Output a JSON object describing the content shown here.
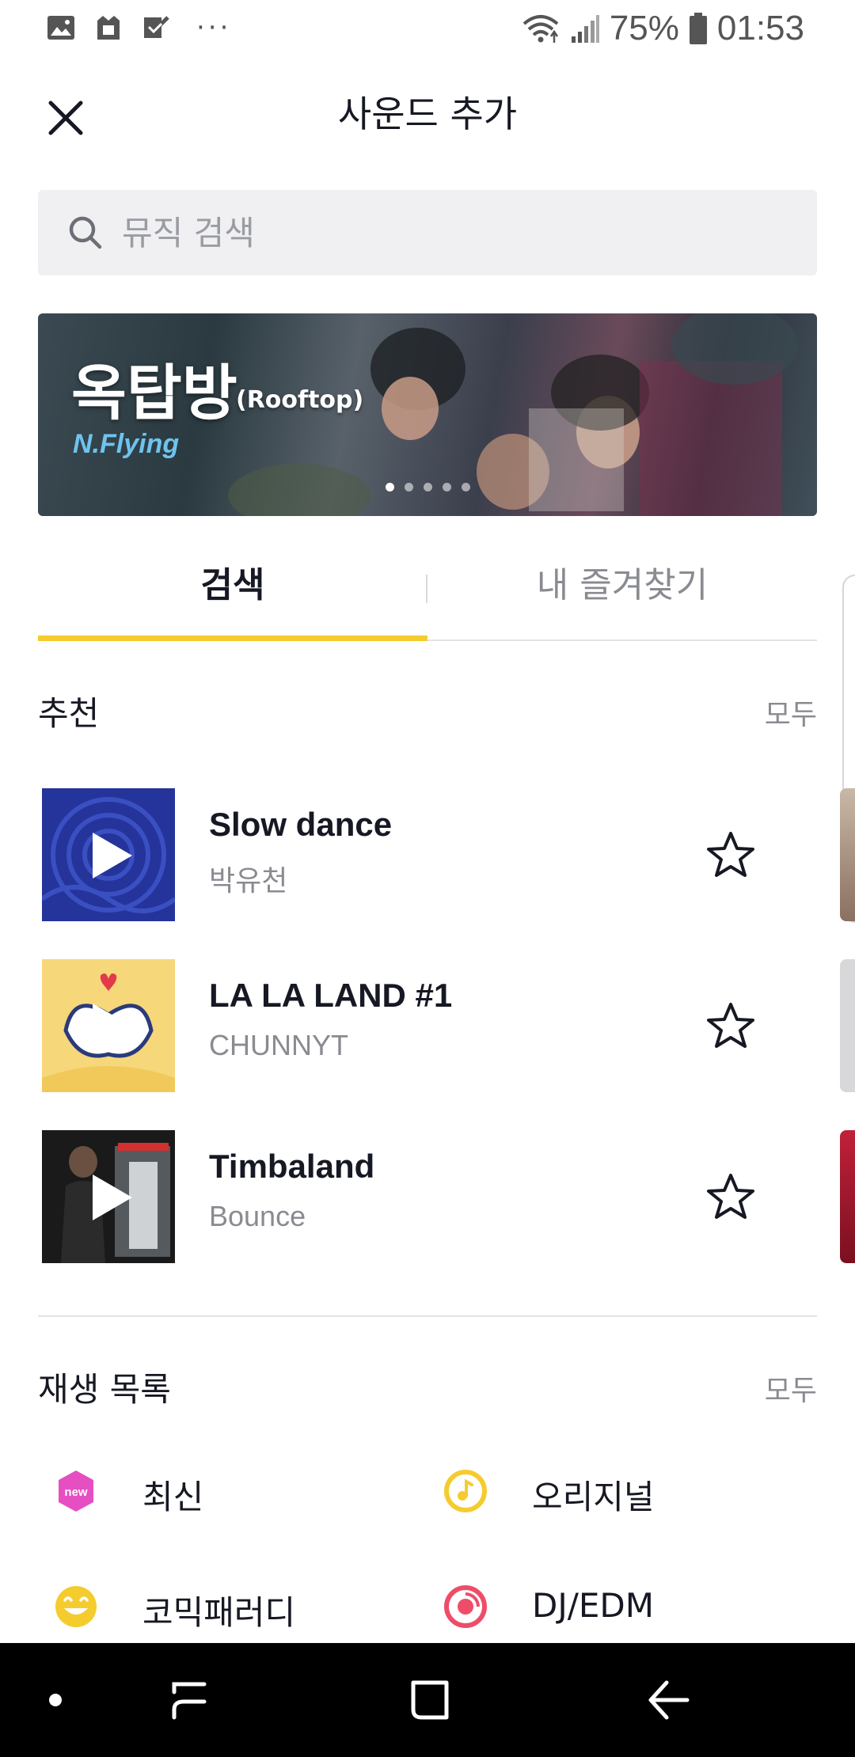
{
  "status_bar": {
    "battery": "75%",
    "time": "01:53",
    "more": "···",
    "icons": [
      "image-icon",
      "notification-icon",
      "checklist-icon",
      "wifi-icon",
      "signal-icon",
      "battery-icon"
    ]
  },
  "header": {
    "title": "사운드 추가",
    "close_icon": "close-icon"
  },
  "search": {
    "placeholder": "뮤직 검색",
    "value": ""
  },
  "banner": {
    "title": "옥탑방",
    "subtitle": "(Rooftop)",
    "artist": "N.Flying",
    "dots": 5,
    "active_dot": 0
  },
  "tabs": [
    {
      "label": "검색",
      "active": true
    },
    {
      "label": "내 즐겨찾기",
      "active": false
    }
  ],
  "recommended": {
    "title": "추천",
    "more": "모두",
    "songs": [
      {
        "title": "Slow dance",
        "artist": "박유천",
        "favorited": false
      },
      {
        "title": "LA LA LAND #1",
        "artist": "CHUNNYT",
        "favorited": false
      },
      {
        "title": "Timbaland",
        "artist": "Bounce",
        "favorited": false
      }
    ]
  },
  "playlists": {
    "title": "재생 목록",
    "more": "모두",
    "items": [
      {
        "label": "최신",
        "icon": "new-badge-icon",
        "color": "#e54fc2"
      },
      {
        "label": "오리지널",
        "icon": "music-note-icon",
        "color": "#f5cc2e"
      },
      {
        "label": "코믹패러디",
        "icon": "smiley-icon",
        "color": "#f5cc2e"
      },
      {
        "label": "DJ/EDM",
        "icon": "disc-icon",
        "color": "#ee4d6a"
      }
    ]
  },
  "colors": {
    "accent": "#f5cc2e",
    "text_primary": "#161823",
    "text_secondary": "#8a8b91"
  },
  "nav_bar": [
    "recent-dot-icon",
    "recent-apps-icon",
    "home-icon",
    "back-icon"
  ]
}
